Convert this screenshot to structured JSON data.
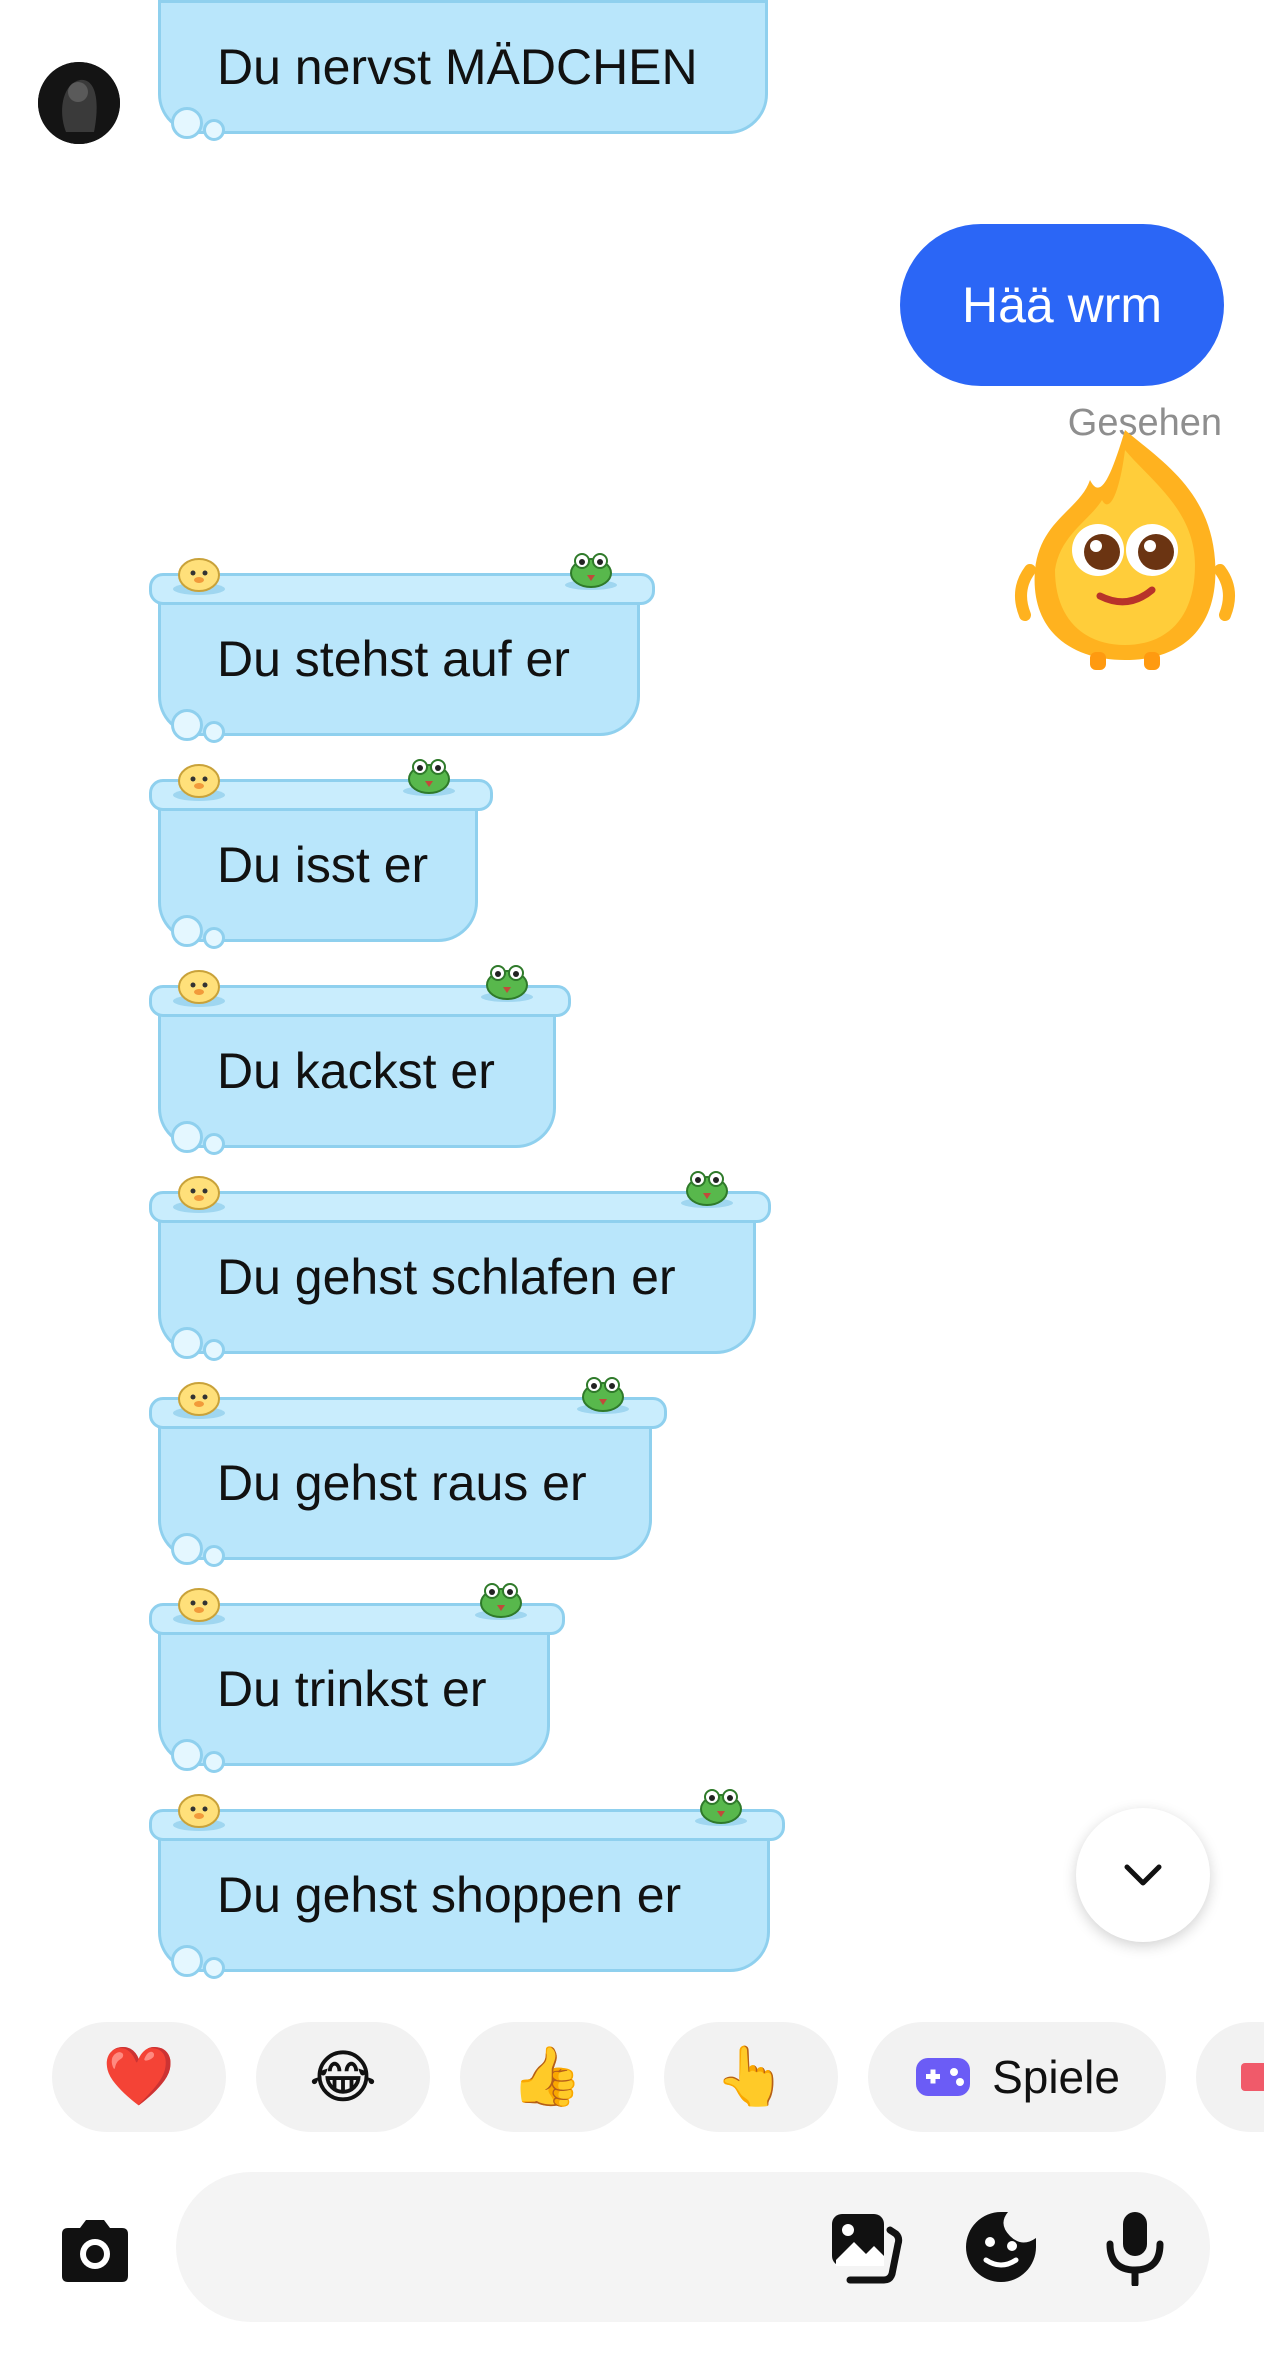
{
  "conversation": {
    "incoming": [
      {
        "text": "Du nervst MÄDCHEN"
      },
      {
        "text": "Du stehst auf er"
      },
      {
        "text": "Du isst er"
      },
      {
        "text": "Du kackst er"
      },
      {
        "text": "Du gehst schlafen er"
      },
      {
        "text": "Du gehst raus er"
      },
      {
        "text": "Du trinkst er"
      },
      {
        "text": "Du gehst shoppen er"
      }
    ],
    "outgoing": [
      {
        "text": "Hää wrm",
        "status": "Gesehen"
      }
    ]
  },
  "quick_reactions": {
    "items": [
      "❤️",
      "😂",
      "👍",
      "👆"
    ],
    "games_label": "Spiele"
  },
  "icons": {
    "scroll": "chevron-down-icon",
    "camera": "camera-icon",
    "gallery": "gallery-icon",
    "sticker": "sticker-icon",
    "mic": "microphone-icon"
  },
  "colors": {
    "incoming_bubble": "#b9e6fb",
    "outgoing_bubble": "#2b66f6",
    "games_icon": "#6b5cf6"
  }
}
